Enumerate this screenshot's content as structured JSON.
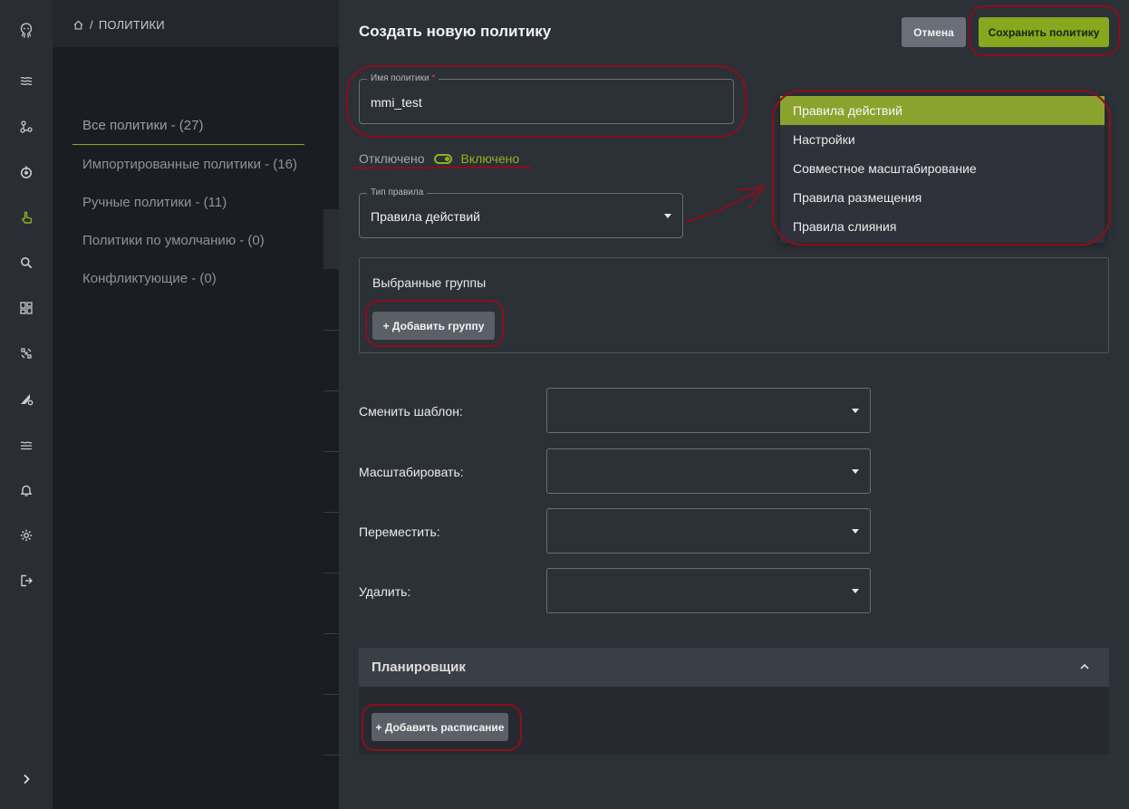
{
  "breadcrumb": {
    "separator": "/",
    "current": "ПОЛИТИКИ"
  },
  "sidebar_icons": [
    "octopus-logo-icon",
    "layers-icon",
    "nodes-icon",
    "power-icon",
    "hand-pointer-icon",
    "search-icon",
    "dashboard-icon",
    "grid-icon",
    "brush-settings-icon",
    "waves-icon",
    "bell-icon",
    "gear-icon",
    "logout-icon",
    "chevron-right-icon"
  ],
  "policy_list": [
    {
      "label": "Все политики - (27)"
    },
    {
      "label": "Импортированные политики - (16)"
    },
    {
      "label": "Ручные политики - (11)"
    },
    {
      "label": "Политики по умолчанию - (0)"
    },
    {
      "label": "Конфликтующие - (0)"
    }
  ],
  "drawer": {
    "title": "Создать новую политику",
    "cancel_label": "Отмена",
    "save_label": "Сохранить политику"
  },
  "policy_name": {
    "label": "Имя политики",
    "required_mark": "*",
    "value": "mmi_test"
  },
  "status_toggle": {
    "off_label": "Отключено",
    "on_label": "Включено"
  },
  "rule_type": {
    "label": "Тип правила",
    "value": "Правила действий",
    "options": [
      "Правила действий",
      "Настройки",
      "Совместное масштабирование",
      "Правила размещения",
      "Правила слияния"
    ]
  },
  "groups": {
    "title": "Выбранные группы",
    "add_label": "+ Добавить группу"
  },
  "actions": [
    {
      "label": "Сменить шаблон:"
    },
    {
      "label": "Масштабировать:"
    },
    {
      "label": "Переместить:"
    },
    {
      "label": "Удалить:"
    }
  ],
  "scheduler": {
    "title": "Планировщик",
    "add_label": "+ Добавить расписание"
  },
  "colors": {
    "accent": "#87a81e",
    "annotation": "#8b0f1e",
    "drawer_bg": "#2c3037"
  }
}
